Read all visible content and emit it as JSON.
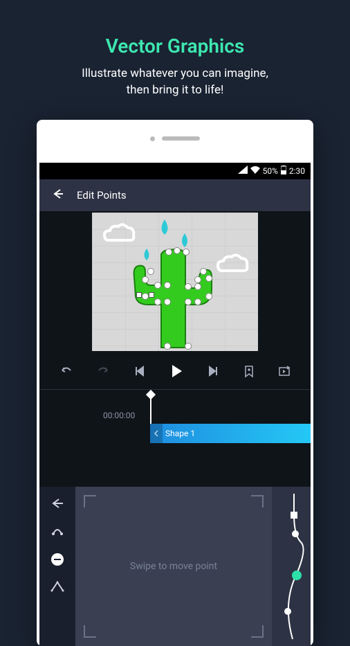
{
  "promo": {
    "title": "Vector Graphics",
    "subtitle_line1": "Illustrate whatever you can imagine,",
    "subtitle_line2": "then bring it to life!"
  },
  "statusbar": {
    "battery_pct": "50%",
    "time": "2:30"
  },
  "header": {
    "title": "Edit Points"
  },
  "playback": {
    "undo": "undo",
    "redo": "redo",
    "start": "skip-start",
    "play": "play",
    "end": "skip-end",
    "bookmark": "bookmark",
    "loop": "replay"
  },
  "timeline": {
    "timecode": "00:00:00",
    "track_label": "Shape 1"
  },
  "editor": {
    "hint": "Swipe to move point"
  },
  "colors": {
    "accent": "#3de8b0",
    "cactus": "#33cc1e",
    "raindrop": "#2ec9d6"
  }
}
